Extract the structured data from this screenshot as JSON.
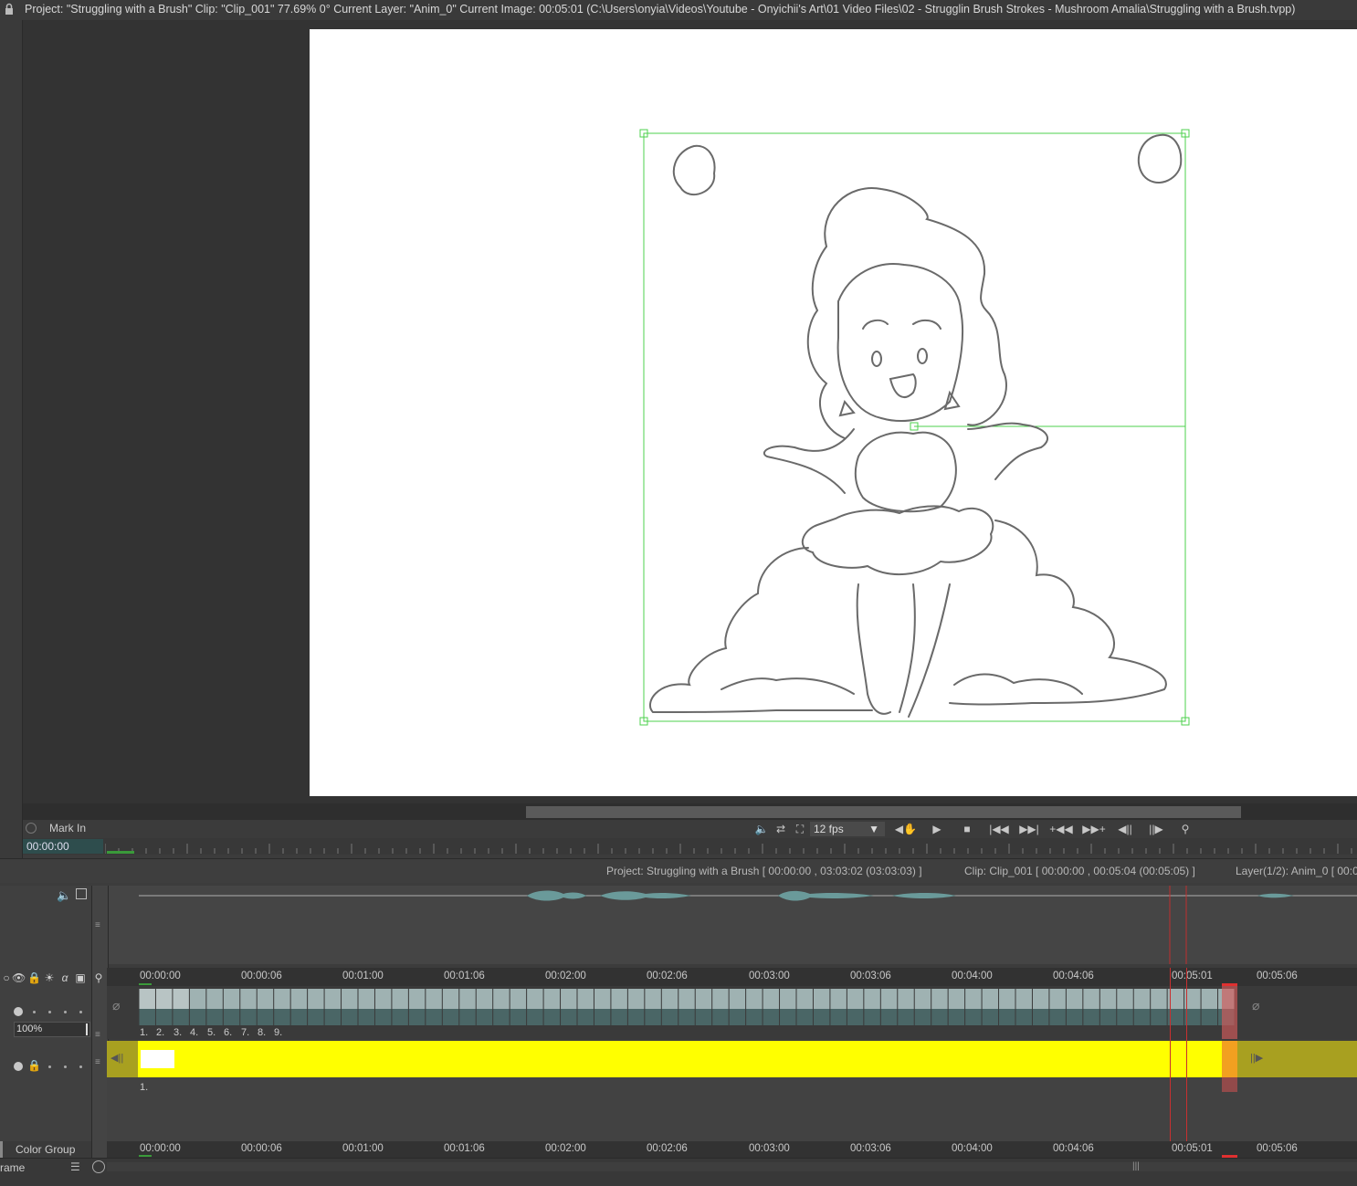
{
  "titlebar": {
    "text": "Project:  \"Struggling with a Brush\"  Clip: \"Clip_001\"   77.69%   0°  Current Layer: \"Anim_0\"  Current Image: 00:05:01 (C:\\Users\\onyia\\Videos\\Youtube - Onyichii's Art\\01 Video Files\\02 - Strugglin Brush Strokes - Mushroom Amalia\\Struggling with a Brush.tvpp)"
  },
  "playbar": {
    "mark_in": "Mark In",
    "timecode": "00:00:00",
    "fps": "12 fps"
  },
  "infobar": {
    "project": "Project: Struggling with a Brush [ 00:00:00 , 03:03:02  (03:03:03) ]",
    "clip": "Clip: Clip_001 [ 00:00:00 , 00:05:04  (00:05:05) ]",
    "layer": "Layer(1/2): Anim_0 [ 00:0"
  },
  "timeline": {
    "ruler_labels": [
      "00:00:00",
      "00:00:06",
      "00:01:00",
      "00:01:06",
      "00:02:00",
      "00:02:06",
      "00:03:00",
      "00:03:06",
      "00:04:00",
      "00:04:06",
      "00:05:01",
      "00:05:06"
    ],
    "frame_numbers": [
      "1.",
      "2.",
      "3.",
      "4.",
      "5.",
      "6.",
      "7.",
      "8.",
      "9."
    ],
    "opacity": "100%",
    "track2_frame": "1."
  },
  "bottom": {
    "color_group": "Color Group",
    "frame_label": "rame"
  },
  "colors": {
    "yellow_track": "#ffff00",
    "selection_box": "#33cc33",
    "playhead": "#d83030"
  }
}
